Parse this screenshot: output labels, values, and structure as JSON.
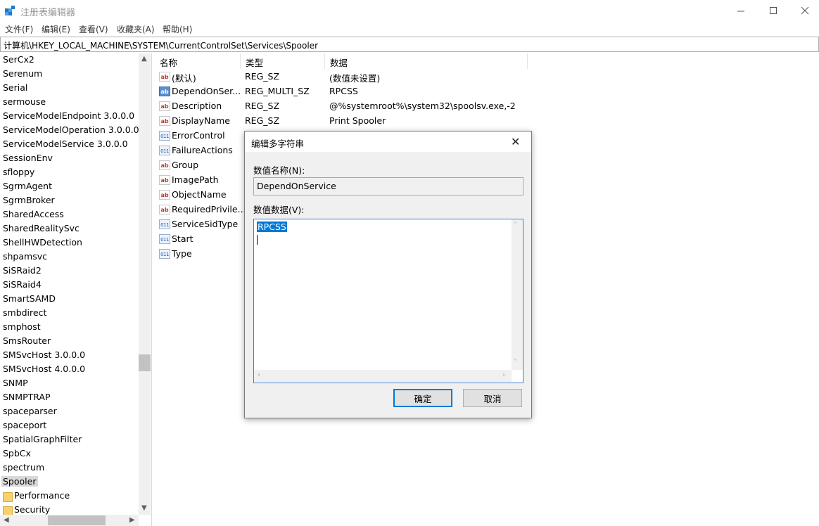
{
  "window": {
    "title": "注册表编辑器",
    "icon": "regedit-icon"
  },
  "menu": [
    "文件(F)",
    "编辑(E)",
    "查看(V)",
    "收藏夹(A)",
    "帮助(H)"
  ],
  "address": "计算机\\HKEY_LOCAL_MACHINE\\SYSTEM\\CurrentControlSet\\Services\\Spooler",
  "tree": {
    "items": [
      "SerCx2",
      "Serenum",
      "Serial",
      "sermouse",
      "ServiceModelEndpoint 3.0.0.0",
      "ServiceModelOperation 3.0.0.0",
      "ServiceModelService 3.0.0.0",
      "SessionEnv",
      "sfloppy",
      "SgrmAgent",
      "SgrmBroker",
      "SharedAccess",
      "SharedRealitySvc",
      "ShellHWDetection",
      "shpamsvc",
      "SiSRaid2",
      "SiSRaid4",
      "SmartSAMD",
      "smbdirect",
      "smphost",
      "SmsRouter",
      "SMSvcHost 3.0.0.0",
      "SMSvcHost 4.0.0.0",
      "SNMP",
      "SNMPTRAP",
      "spaceparser",
      "spaceport",
      "SpatialGraphFilter",
      "SpbCx",
      "spectrum",
      "Spooler"
    ],
    "selected": "Spooler",
    "subkeys": [
      "Performance",
      "Security"
    ]
  },
  "list": {
    "columns": [
      "名称",
      "类型",
      "数据"
    ],
    "rows": [
      {
        "name": "(默认)",
        "type": "REG_SZ",
        "data": "(数值未设置)",
        "icon": "string-value-icon"
      },
      {
        "name": "DependOnSer...",
        "type": "REG_MULTI_SZ",
        "data": "RPCSS",
        "icon": "multi-string-value-icon"
      },
      {
        "name": "Description",
        "type": "REG_SZ",
        "data": "@%systemroot%\\system32\\spoolsv.exe,-2",
        "icon": "string-value-icon"
      },
      {
        "name": "DisplayName",
        "type": "REG_SZ",
        "data": "Print Spooler",
        "icon": "string-value-icon"
      },
      {
        "name": "ErrorControl",
        "type": "",
        "data": "",
        "icon": "binary-value-icon"
      },
      {
        "name": "FailureActions",
        "type": "",
        "data": "",
        "icon": "binary-value-icon"
      },
      {
        "name": "Group",
        "type": "",
        "data": "",
        "icon": "string-value-icon"
      },
      {
        "name": "ImagePath",
        "type": "",
        "data": "",
        "icon": "string-value-icon"
      },
      {
        "name": "ObjectName",
        "type": "",
        "data": "",
        "icon": "string-value-icon"
      },
      {
        "name": "RequiredPrivile...",
        "type": "",
        "data": "",
        "icon": "string-value-icon"
      },
      {
        "name": "ServiceSidType",
        "type": "",
        "data": "",
        "icon": "binary-value-icon"
      },
      {
        "name": "Start",
        "type": "",
        "data": "",
        "icon": "binary-value-icon"
      },
      {
        "name": "Type",
        "type": "",
        "data": "",
        "icon": "binary-value-icon"
      }
    ]
  },
  "dialog": {
    "title": "编辑多字符串",
    "name_label": "数值名称(N):",
    "name_value": "DependOnService",
    "data_label": "数值数据(V):",
    "data_value": "RPCSS",
    "ok_label": "确定",
    "cancel_label": "取消"
  },
  "colors": {
    "selection": "#0078d7",
    "tree_selected": "#d9d9d9"
  }
}
